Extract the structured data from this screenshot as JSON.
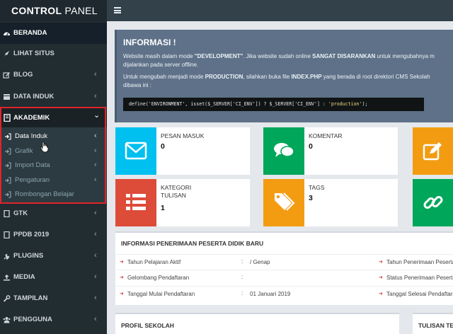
{
  "brand": {
    "bold": "CONTROL",
    "rest": " PANEL"
  },
  "topbar": {
    "menu_icon": "hamburger-icon"
  },
  "sidebar": {
    "items": [
      {
        "label": "BERANDA",
        "icon": "dashboard-icon",
        "active": true
      },
      {
        "label": "LIHAT SITUS",
        "icon": "rocket-icon"
      },
      {
        "label": "BLOG",
        "icon": "edit-icon",
        "chevron": "‹"
      },
      {
        "label": "DATA INDUK",
        "icon": "database-icon",
        "chevron": "‹"
      }
    ],
    "akademik": {
      "label": "AKADEMIK",
      "icon": "book-icon",
      "chevron": "⌄",
      "subitems": [
        {
          "label": "Data Induk",
          "current": true,
          "chevron": "‹"
        },
        {
          "label": "Grafik",
          "chevron": "‹"
        },
        {
          "label": "Import Data",
          "chevron": "‹"
        },
        {
          "label": "Pengaturan",
          "chevron": "‹"
        },
        {
          "label": "Rombongan Belajar"
        }
      ]
    },
    "items_after": [
      {
        "label": "GTK",
        "icon": "doc-icon",
        "chevron": "‹"
      },
      {
        "label": "PPDB 2019",
        "icon": "doc-icon",
        "chevron": "‹"
      },
      {
        "label": "PLUGINS",
        "icon": "plug-icon",
        "chevron": "‹"
      },
      {
        "label": "MEDIA",
        "icon": "upload-icon",
        "chevron": "‹"
      },
      {
        "label": "TAMPILAN",
        "icon": "wrench-icon",
        "chevron": "‹"
      },
      {
        "label": "PENGGUNA",
        "icon": "users-icon",
        "chevron": "‹"
      }
    ]
  },
  "info": {
    "title": "INFORMASI !",
    "line1a": "Website masih dalam mode ",
    "line1b": "\"DEVELOPMENT\"",
    "line1c": ". Jika website sudah online ",
    "line1d": "SANGAT DISARANKAN",
    "line1e": " untuk mengubahnya m",
    "line2": "dijalankan pada server offline.",
    "line3a": "Untuk mengubah menjadi mode ",
    "line3b": "PRODUCTION",
    "line3c": ", silahkan buka file ",
    "line3d": "INDEX.PHP",
    "line3e": " yang berada di root direktori CMS Sekolah",
    "line4": "dibawa ini :",
    "code_a": "define('ENVIRONMENT', isset($_SERVER['CI_ENV']) ? $_SERVER['CI_ENV'] : ",
    "code_b": "'production'",
    "code_c": ");"
  },
  "cards": [
    {
      "title": "PESAN MASUK",
      "value": "0",
      "color": "#00c0ef",
      "icon": "envelope-icon"
    },
    {
      "title": "KOMENTAR",
      "value": "0",
      "color": "#00a65a",
      "icon": "comments-icon"
    },
    {
      "title": "",
      "value": "",
      "color": "#f39c12",
      "icon": "edit-icon"
    },
    {
      "title": "KATEGORI TULISAN",
      "title_line2": "",
      "value": "1",
      "color": "#dd4b39",
      "icon": "list-icon"
    },
    {
      "title": "TAGS",
      "value": "3",
      "color": "#f39c12",
      "icon": "tags-icon"
    },
    {
      "title": "",
      "value": "",
      "color": "#00a65a",
      "icon": "link-icon"
    }
  ],
  "ppdb": {
    "heading": "INFORMASI PENERIMAAN PESERTA DIDIK BARU",
    "rows": [
      {
        "key": "Tahun Pelajaran Aktif",
        "sep": ":",
        "value": "/ Genap",
        "key2": "Tahun Penerimaan Peserta D"
      },
      {
        "key": "Gelombang Pendaftaran",
        "sep": ":",
        "value": "",
        "key2": "Status Penerimaan Peserta D"
      },
      {
        "key": "Tanggal Mulai Pendaftaran",
        "sep": ":",
        "value": "01 Januari 2019",
        "key2": "Tanggal Selesai Pendaftaran"
      }
    ]
  },
  "profil": {
    "heading": "PROFIL SEKOLAH"
  },
  "tulisan": {
    "heading": "TULISAN TE"
  }
}
